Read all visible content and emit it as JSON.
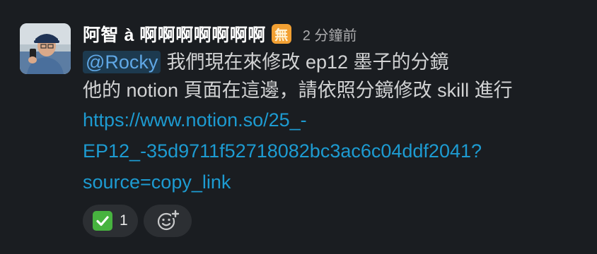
{
  "message": {
    "sender": "阿智 à 啊啊啊啊啊啊啊",
    "status_emoji": "無",
    "timestamp": "2 分鐘前",
    "mention": "@Rocky",
    "line1_rest": "我們現在來修改 ep12 墨子的分鏡",
    "line2": "他的 notion 頁面在這邊，請依照分鏡修改 skill 進行",
    "link_line1": "https://www.notion.so/25_-",
    "link_line2": "EP12_-35d9711f52718082bc3ac6c04ddf2041?",
    "link_line3": "source=copy_link"
  },
  "reactions": [
    {
      "icon": "white-check-mark-icon",
      "count": "1"
    }
  ],
  "add_reaction_icon": "add-reaction-icon",
  "colors": {
    "background": "#1a1d21",
    "link": "#1d9bd1",
    "mention_bg": "#1d3a4f",
    "mention_fg": "#60a8e6",
    "check": "#47b33f",
    "status": "#f2a033"
  }
}
